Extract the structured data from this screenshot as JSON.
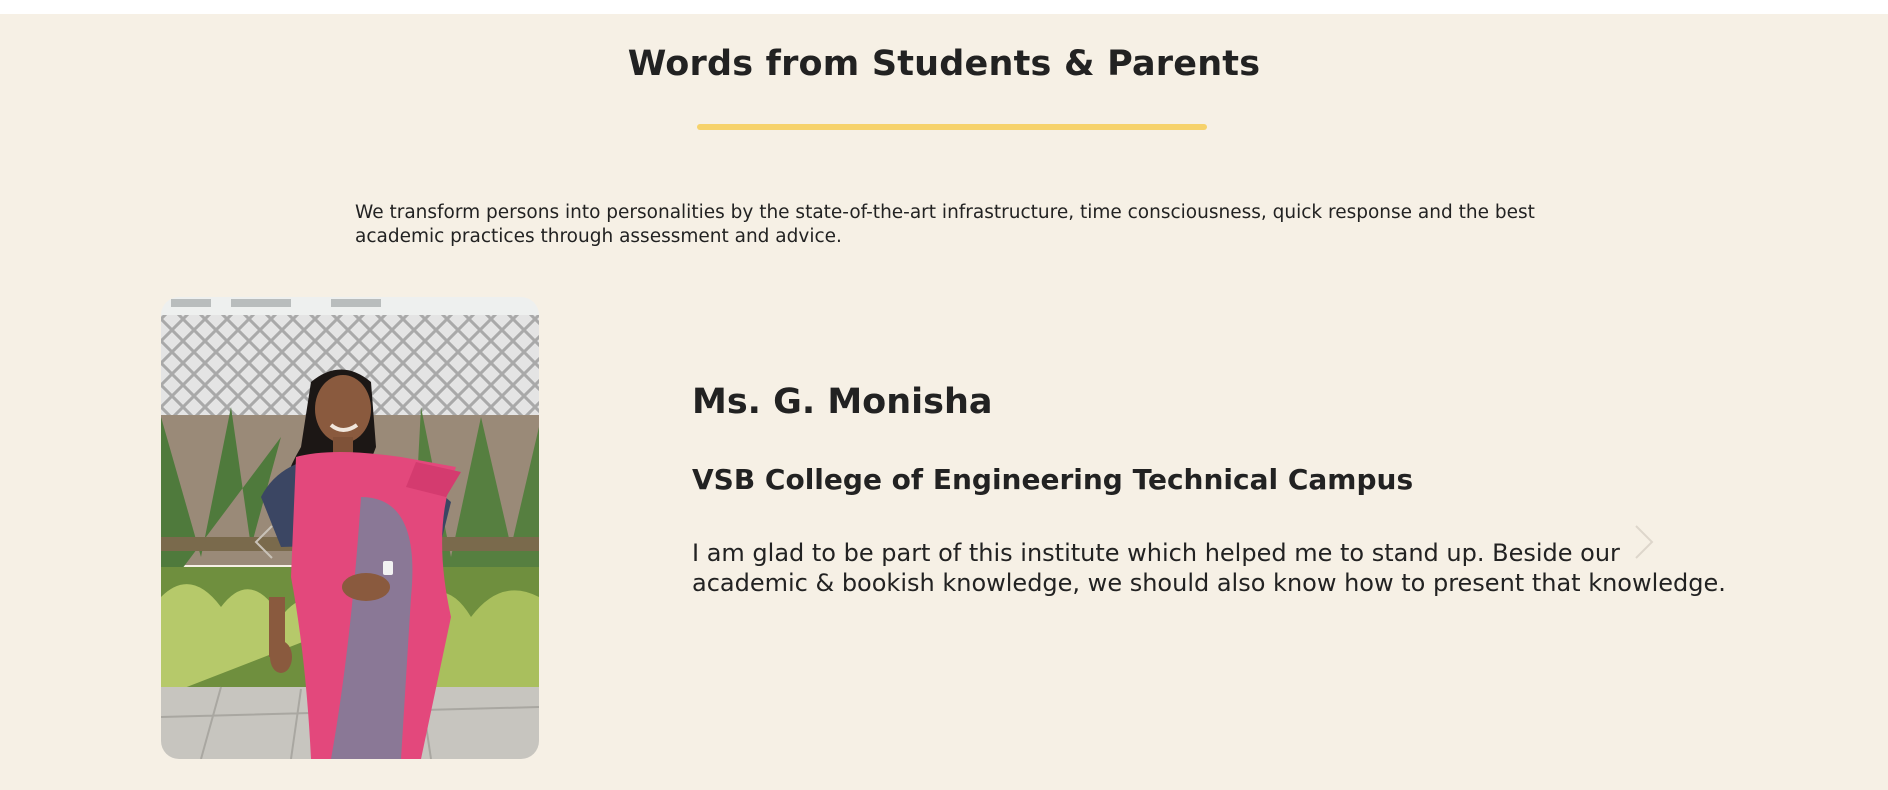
{
  "section": {
    "heading": "Words from Students & Parents",
    "intro": "We transform persons into personalities by the state-of-the-art infrastructure, time consciousness, quick response and the best academic practices through assessment and advice."
  },
  "testimonial": {
    "name": "Ms. G. Monisha",
    "college": "VSB College of Engineering Technical Campus",
    "quote": "I am glad to be part of this institute which helped me to stand up. Beside our academic & bookish knowledge, we should also know how to present that knowledge."
  },
  "icons": {
    "prev": "chevron-left-icon",
    "next": "chevron-right-icon"
  },
  "colors": {
    "background": "#f6f0e5",
    "accent_underline": "#f6d26b",
    "text": "#222222"
  }
}
